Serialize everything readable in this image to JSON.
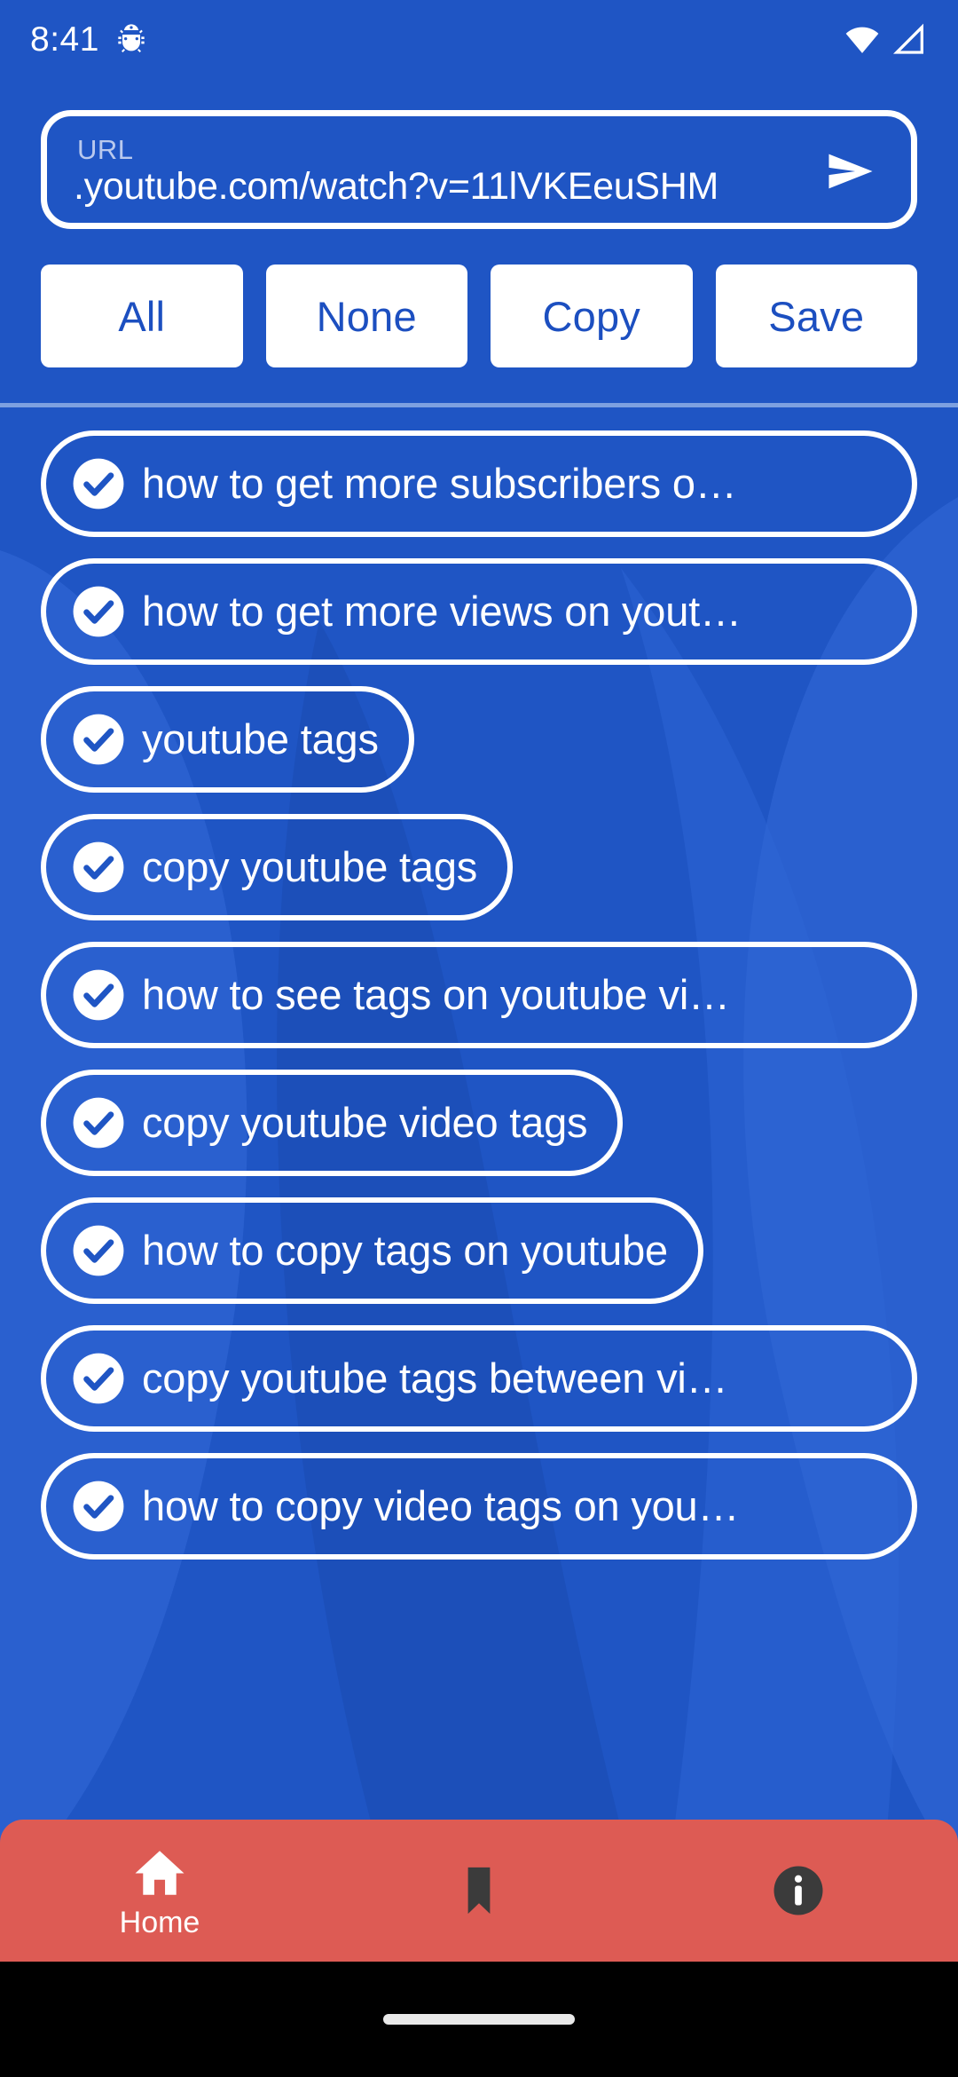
{
  "theme": {
    "background": "#1f55c4",
    "accent_white": "#ffffff",
    "button_text": "#1c4fc0",
    "divider": "#7da0e0",
    "nav_background": "#dd5b54",
    "nav_inactive_icon": "#3b3b3b",
    "url_label": "#b9c9ee"
  },
  "statusbar": {
    "time": "8:41",
    "icons": {
      "left": "android-bug-icon",
      "wifi": "wifi-icon",
      "signal": "signal-icon"
    }
  },
  "url_field": {
    "label": "URL",
    "value": ".youtube.com/watch?v=11lVKEeuSHM",
    "placeholder": "URL",
    "send_icon": "send-icon"
  },
  "actions": [
    {
      "id": "all",
      "label": "All"
    },
    {
      "id": "none",
      "label": "None"
    },
    {
      "id": "copy",
      "label": "Copy"
    },
    {
      "id": "save",
      "label": "Save"
    }
  ],
  "tags": [
    {
      "label": "how to get more subscribers o…",
      "checked": true,
      "wide": true
    },
    {
      "label": "how to get more views on yout…",
      "checked": true,
      "wide": true
    },
    {
      "label": "youtube tags",
      "checked": true,
      "wide": false
    },
    {
      "label": "copy youtube tags",
      "checked": true,
      "wide": false
    },
    {
      "label": "how to see tags on youtube vi…",
      "checked": true,
      "wide": true
    },
    {
      "label": "copy youtube video tags",
      "checked": true,
      "wide": false
    },
    {
      "label": "how to copy tags on youtube",
      "checked": true,
      "wide": false
    },
    {
      "label": "copy youtube tags between vi…",
      "checked": true,
      "wide": true
    },
    {
      "label": "how to copy video tags on you…",
      "checked": true,
      "wide": true
    }
  ],
  "bottom_nav": [
    {
      "id": "home",
      "label": "Home",
      "icon": "home-icon",
      "active": true
    },
    {
      "id": "saved",
      "label": "",
      "icon": "bookmark-icon",
      "active": false
    },
    {
      "id": "info",
      "label": "",
      "icon": "info-icon",
      "active": false
    }
  ]
}
